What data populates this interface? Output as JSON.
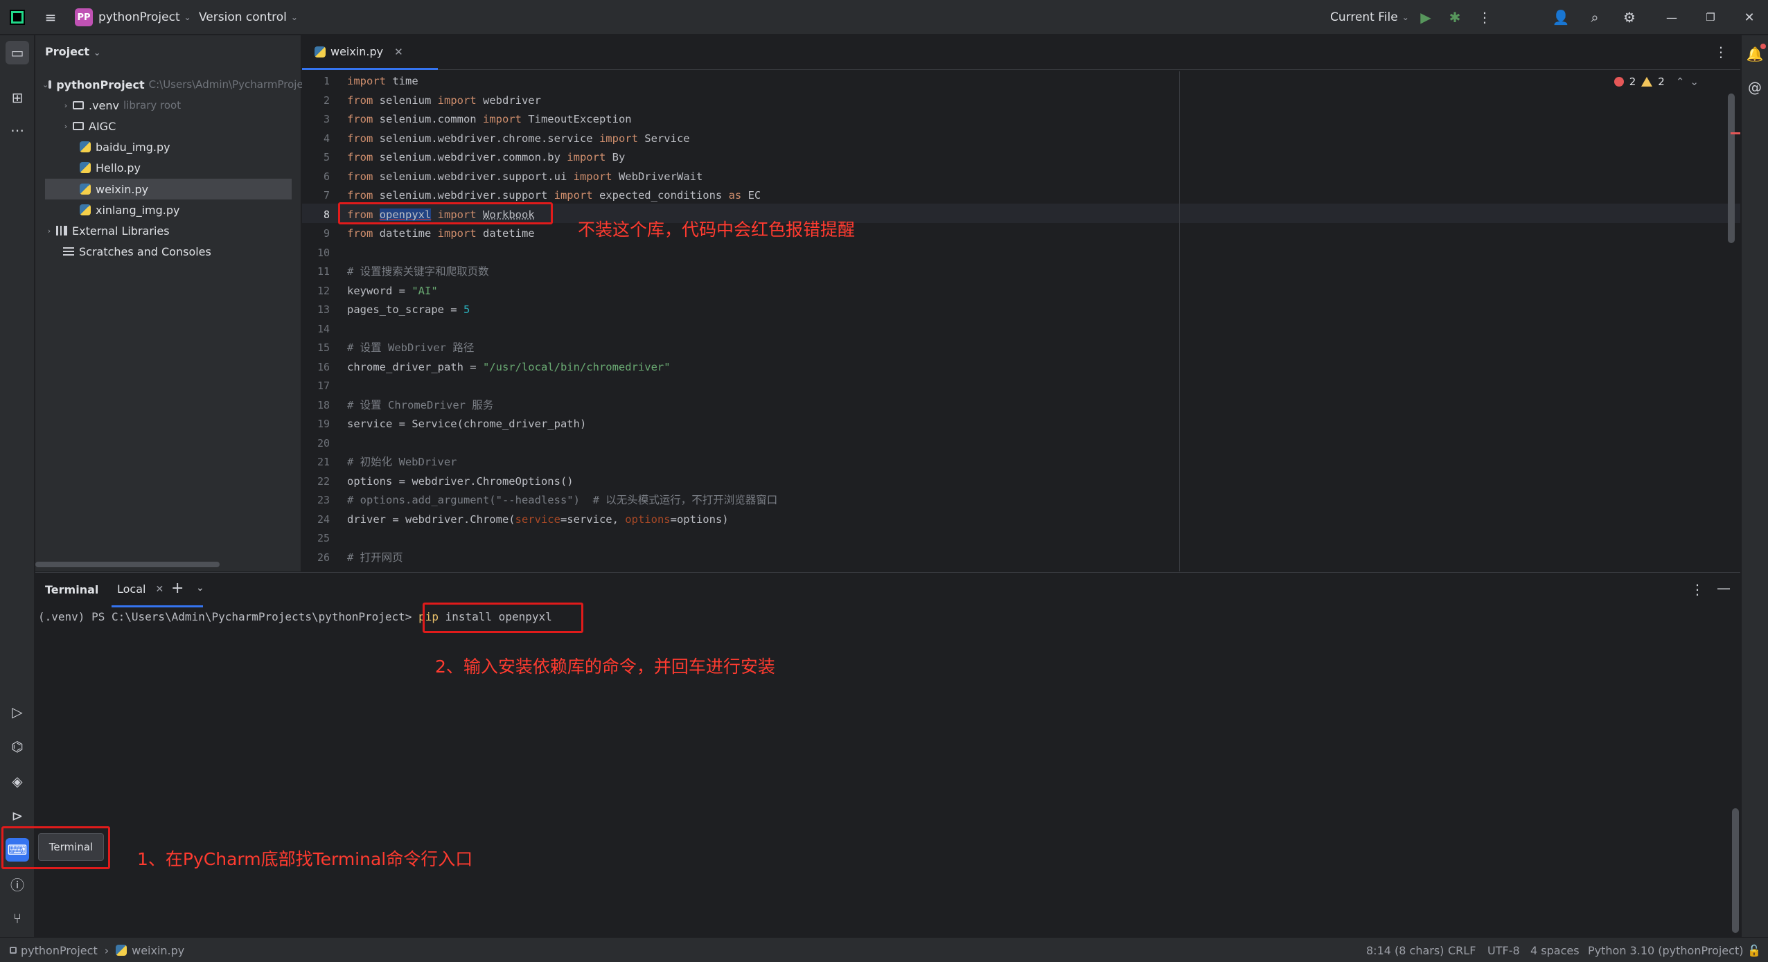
{
  "titlebar": {
    "project_badge": "PP",
    "project_name": "pythonProject",
    "version_control": "Version control",
    "run_config": "Current File"
  },
  "project_panel": {
    "title": "Project",
    "tree": [
      {
        "label": "pythonProject",
        "hint": "C:\\Users\\Admin\\PycharmProjects\\pythonProject",
        "type": "folder",
        "expanded": true
      },
      {
        "label": ".venv",
        "hint": "library root",
        "type": "folder",
        "expanded": false
      },
      {
        "label": "AIGC",
        "hint": "",
        "type": "folder",
        "expanded": false
      },
      {
        "label": "baidu_img.py",
        "hint": "",
        "type": "python"
      },
      {
        "label": "Hello.py",
        "hint": "",
        "type": "python"
      },
      {
        "label": "weixin.py",
        "hint": "",
        "type": "python",
        "selected": true
      },
      {
        "label": "xinlang_img.py",
        "hint": "",
        "type": "python"
      },
      {
        "label": "External Libraries",
        "hint": "",
        "type": "library"
      },
      {
        "label": "Scratches and Consoles",
        "hint": "",
        "type": "scratch"
      }
    ]
  },
  "editor": {
    "tab": "weixin.py",
    "current_line": 8,
    "inspections": {
      "errors": "2",
      "warnings": "2"
    },
    "line_numbers": [
      "1",
      "2",
      "3",
      "4",
      "5",
      "6",
      "7",
      "8",
      "9",
      "10",
      "11",
      "12",
      "13",
      "14",
      "15",
      "16",
      "17",
      "18",
      "19",
      "20",
      "21",
      "22",
      "23",
      "24",
      "25",
      "26"
    ],
    "annotation": "不装这个库，代码中会红色报错提醒"
  },
  "terminal": {
    "title": "Terminal",
    "tab": "Local",
    "prompt": "(.venv) PS C:\\Users\\Admin\\PycharmProjects\\pythonProject>",
    "command_pip": "pip",
    "command_rest": " install openpyxl",
    "annotation": "2、输入安装依赖库的命令，并回车进行安装"
  },
  "tooltip": "Terminal",
  "bottom_annotation": "1、在PyCharm底部找Terminal命令行入口",
  "statusbar": {
    "breadcrumb_project": "pythonProject",
    "breadcrumb_file": "weixin.py",
    "position": "8:14 (8 chars)",
    "line_sep": "CRLF",
    "encoding": "UTF-8",
    "indent": "4 spaces",
    "interpreter": "Python 3.10 (pythonProject)"
  },
  "icons": {
    "hamburger": "menu-icon",
    "run": "run-icon",
    "debug": "debug-icon",
    "more": "more-icon",
    "add_user": "add-user-icon",
    "search": "search-icon",
    "settings": "settings-icon",
    "minimize": "minimize-icon",
    "restore": "restore-icon",
    "close": "close-icon"
  },
  "colors": {
    "accent": "#3574f0",
    "annotation_red": "#ff3b30",
    "keyword": "#cf8e6d",
    "string": "#6aab73"
  }
}
